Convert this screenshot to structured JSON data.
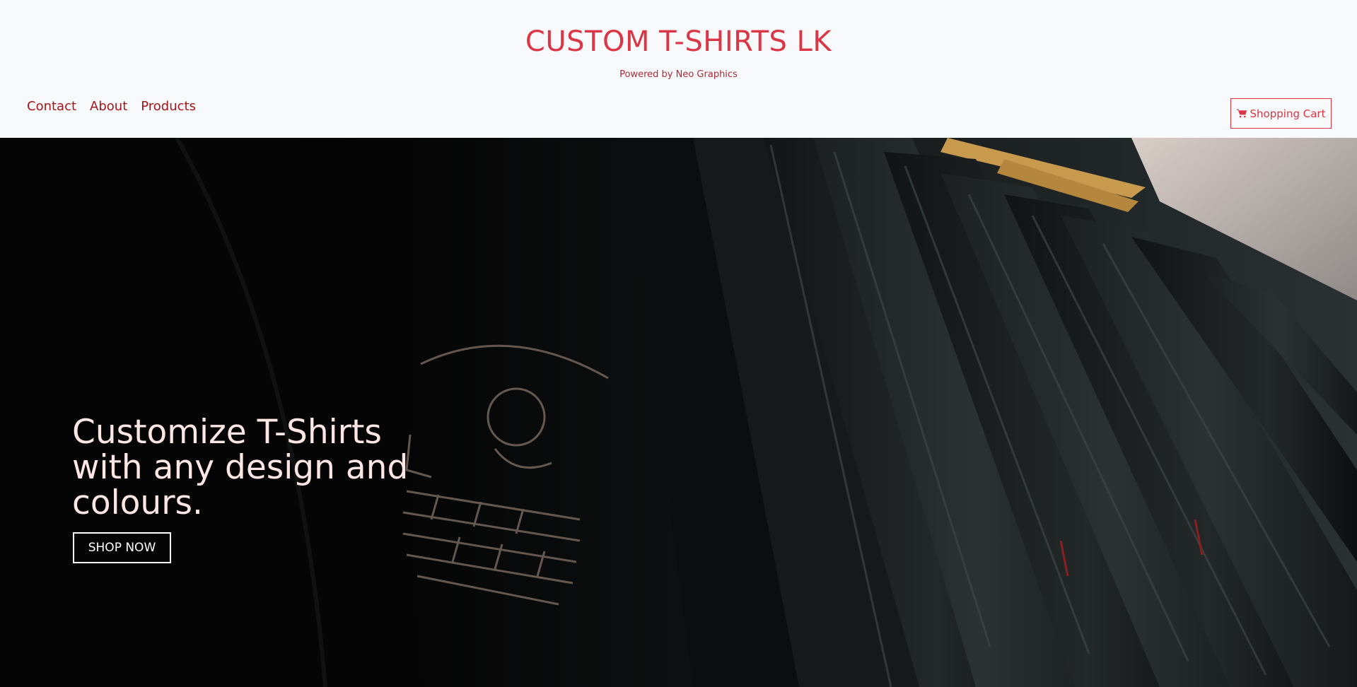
{
  "header": {
    "brand": "CUSTOM T-SHIRTS LK",
    "tagline": "Powered by Neo Graphics",
    "nav": [
      {
        "label": "Contact"
      },
      {
        "label": "About"
      },
      {
        "label": "Products"
      }
    ],
    "cart_label": "Shopping Cart",
    "cart_icon": "shopping-cart-icon",
    "accent_color": "#dc3545"
  },
  "hero": {
    "title": "Customize T-Shirts with any design and colours.",
    "cta_label": "SHOP NOW",
    "background_image": "rack of black t-shirts on hangers"
  }
}
